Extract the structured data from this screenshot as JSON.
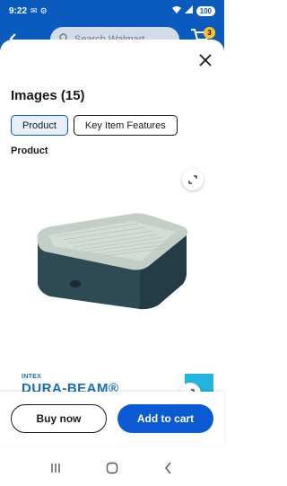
{
  "status_bar": {
    "time": "9:22",
    "battery": "100"
  },
  "header": {
    "search_placeholder": "Search Walmart",
    "cart_count": "3"
  },
  "sheet": {
    "title": "Images (15)",
    "tabs": [
      {
        "label": "Product",
        "active": true
      },
      {
        "label": "Key Item Features",
        "active": false
      }
    ],
    "section_label": "Product",
    "brand_small": "INTEX",
    "brand_large": "DURA-BEAM®"
  },
  "actions": {
    "buy_now": "Buy now",
    "add_to_cart": "Add to cart"
  },
  "colors": {
    "primary": "#0a5bbd",
    "button_blue": "#0a5bd3",
    "badge": "#ffc220"
  }
}
